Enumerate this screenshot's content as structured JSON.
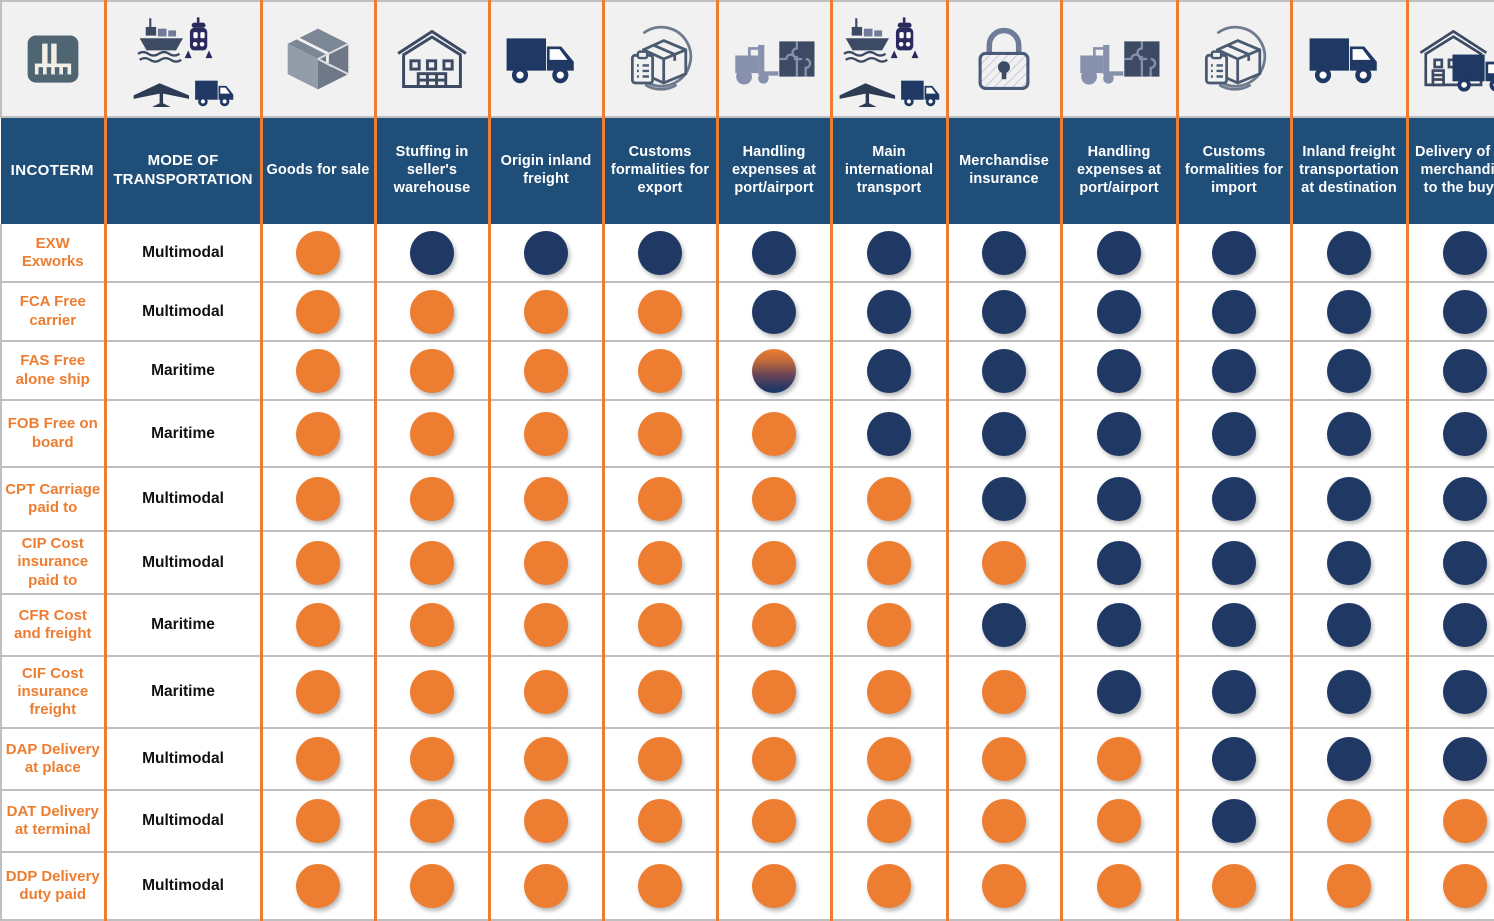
{
  "table": {
    "header_icons": [
      {
        "name": "factory-icon",
        "label": "factory"
      },
      {
        "name": "multimodal-transport-icon",
        "label": "ship-train-plane-truck"
      },
      {
        "name": "package-box-icon",
        "label": "packaged-goods"
      },
      {
        "name": "warehouse-icon",
        "label": "warehouse"
      },
      {
        "name": "truck-icon",
        "label": "inland-truck"
      },
      {
        "name": "customs-clipboard-box-icon",
        "label": "customs-formalities"
      },
      {
        "name": "forklift-handling-icon",
        "label": "port-handling"
      },
      {
        "name": "multimodal-transport-icon-2",
        "label": "ship-train-plane-truck"
      },
      {
        "name": "padlock-insurance-icon",
        "label": "merchandise-insurance"
      },
      {
        "name": "forklift-handling-icon-2",
        "label": "port-handling"
      },
      {
        "name": "customs-clipboard-box-icon-2",
        "label": "customs-formalities-import"
      },
      {
        "name": "truck-icon-2",
        "label": "inland-truck-destination"
      },
      {
        "name": "warehouse-delivery-truck-icon",
        "label": "delivery-to-buyer"
      }
    ],
    "columns": [
      "INCOTERM",
      "MODE OF TRANSPORTATION",
      "Goods for sale",
      "Stuffing  in seller's warehouse",
      "Origin inland freight",
      "Customs formalities for export",
      "Handling expenses at port/airport",
      "Main international transport",
      "Merchandise insurance",
      "Handling expenses at port/airport",
      "Customs formalities for import",
      "Inland freight transportation at destination",
      "Delivery of the merchandise to the buyer"
    ],
    "rows": [
      {
        "incoterm": "EXW Exworks",
        "mode": "Multimodal",
        "dots": [
          "seller",
          "buyer",
          "buyer",
          "buyer",
          "buyer",
          "buyer",
          "buyer",
          "buyer",
          "buyer",
          "buyer",
          "buyer"
        ]
      },
      {
        "incoterm": "FCA\nFree carrier",
        "mode": "Multimodal",
        "dots": [
          "seller",
          "seller",
          "seller",
          "seller",
          "buyer",
          "buyer",
          "buyer",
          "buyer",
          "buyer",
          "buyer",
          "buyer"
        ]
      },
      {
        "incoterm": "FAS\nFree alone ship",
        "mode": "Maritime",
        "dots": [
          "seller",
          "seller",
          "seller",
          "seller",
          "split",
          "buyer",
          "buyer",
          "buyer",
          "buyer",
          "buyer",
          "buyer"
        ]
      },
      {
        "incoterm": "FOB Free on board",
        "mode": "Maritime",
        "dots": [
          "seller",
          "seller",
          "seller",
          "seller",
          "seller",
          "buyer",
          "buyer",
          "buyer",
          "buyer",
          "buyer",
          "buyer"
        ]
      },
      {
        "incoterm": "CPT Carriage paid to",
        "mode": "Multimodal",
        "dots": [
          "seller",
          "seller",
          "seller",
          "seller",
          "seller",
          "seller",
          "buyer",
          "buyer",
          "buyer",
          "buyer",
          "buyer"
        ]
      },
      {
        "incoterm": "CIP    Cost insurance paid to",
        "mode": "Multimodal",
        "dots": [
          "seller",
          "seller",
          "seller",
          "seller",
          "seller",
          "seller",
          "seller",
          "buyer",
          "buyer",
          "buyer",
          "buyer"
        ]
      },
      {
        "incoterm": "CFR\nCost and freight",
        "mode": "Maritime",
        "dots": [
          "seller",
          "seller",
          "seller",
          "seller",
          "seller",
          "seller",
          "buyer",
          "buyer",
          "buyer",
          "buyer",
          "buyer"
        ]
      },
      {
        "incoterm": "CIF\nCost insurance freight",
        "mode": "Maritime",
        "dots": [
          "seller",
          "seller",
          "seller",
          "seller",
          "seller",
          "seller",
          "seller",
          "buyer",
          "buyer",
          "buyer",
          "buyer"
        ]
      },
      {
        "incoterm": "DAP Delivery at place",
        "mode": "Multimodal",
        "dots": [
          "seller",
          "seller",
          "seller",
          "seller",
          "seller",
          "seller",
          "seller",
          "seller",
          "buyer",
          "buyer",
          "buyer"
        ]
      },
      {
        "incoterm": "DAT Delivery at terminal",
        "mode": "Multimodal",
        "dots": [
          "seller",
          "seller",
          "seller",
          "seller",
          "seller",
          "seller",
          "seller",
          "seller",
          "buyer",
          "seller",
          "seller"
        ]
      },
      {
        "incoterm": "DDP Delivery duty paid",
        "mode": "Multimodal",
        "dots": [
          "seller",
          "seller",
          "seller",
          "seller",
          "seller",
          "seller",
          "seller",
          "seller",
          "seller",
          "seller",
          "seller"
        ]
      }
    ]
  },
  "colors": {
    "header_navy": "#1F4E79",
    "accent_orange": "#ED7D31",
    "dot_seller": "#ED7D31",
    "dot_buyer": "#1F3864",
    "grid_gray": "#BFBFBF",
    "icon_panel": "#F1F1F1"
  }
}
